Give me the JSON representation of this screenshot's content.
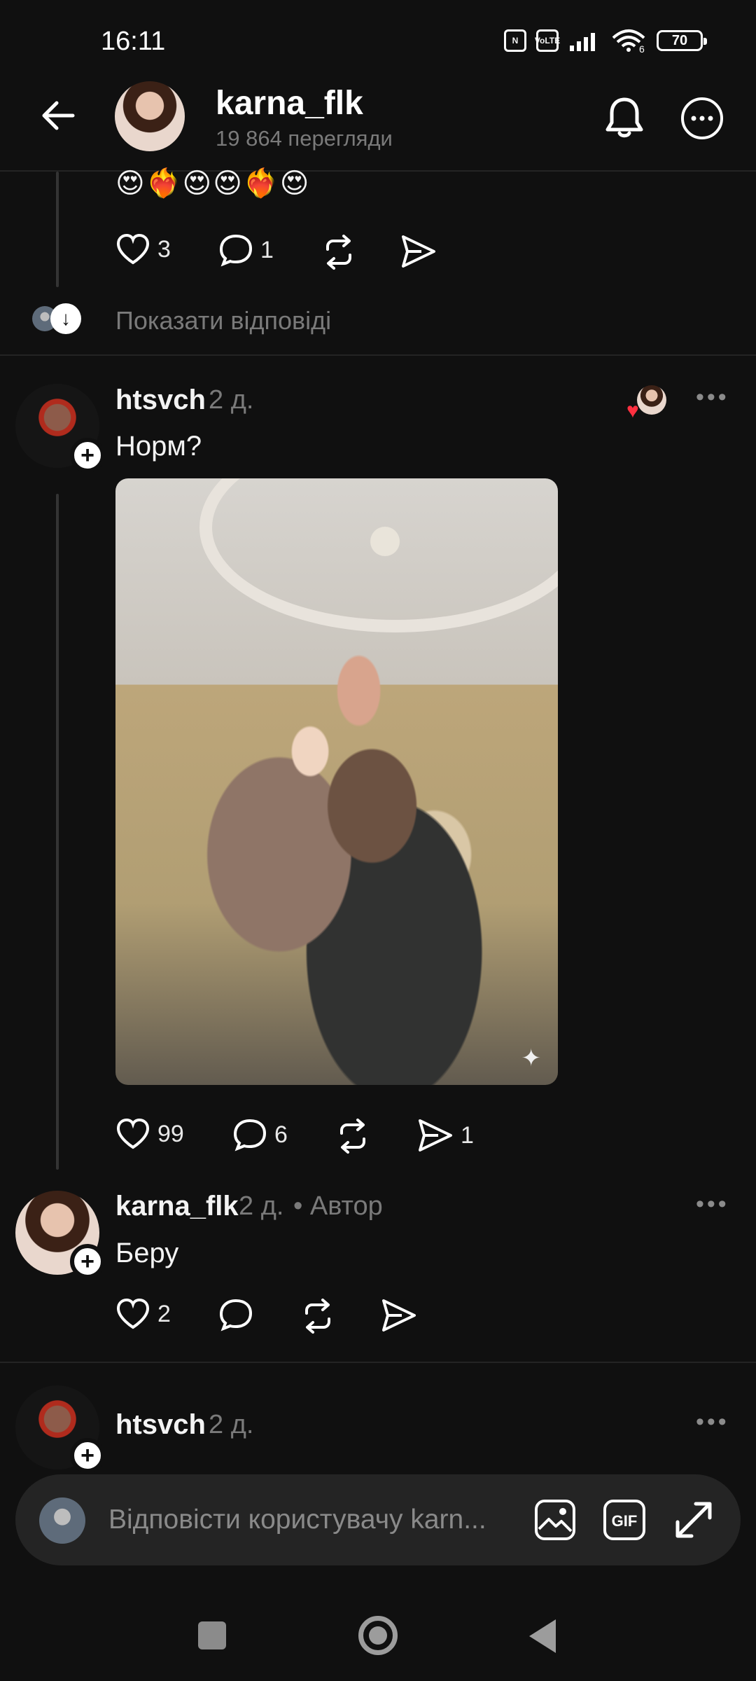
{
  "status": {
    "time": "16:11",
    "battery": "70",
    "signal_label": "Vo\nLTE",
    "wifi_label": "6"
  },
  "header": {
    "username": "karna_flk",
    "views": "19 864 перегляди"
  },
  "previous_reply": {
    "emoji": "😍❤️‍🔥😍😍❤️‍🔥😍",
    "likes": "3",
    "comments": "1"
  },
  "show_replies": "Показати відповіді",
  "comment1": {
    "author": "htsvch",
    "time": "2 д.",
    "text": "Норм?",
    "likes": "99",
    "comments": "6",
    "shares": "1"
  },
  "comment2": {
    "author": "karna_flk",
    "time": "2 д.",
    "author_badge": "• Автор",
    "text": "Беру",
    "likes": "2"
  },
  "comment3": {
    "author": "htsvch",
    "time": "2 д."
  },
  "reply_input": {
    "placeholder": "Відповісти користувачу karn..."
  },
  "icons": {
    "back": "back-arrow-icon",
    "bell": "bell-icon",
    "more": "more-icon",
    "heart": "heart-icon",
    "comment": "comment-icon",
    "repost": "repost-icon",
    "share": "share-icon",
    "image": "image-icon",
    "gif": "gif-icon",
    "expand": "expand-icon"
  }
}
